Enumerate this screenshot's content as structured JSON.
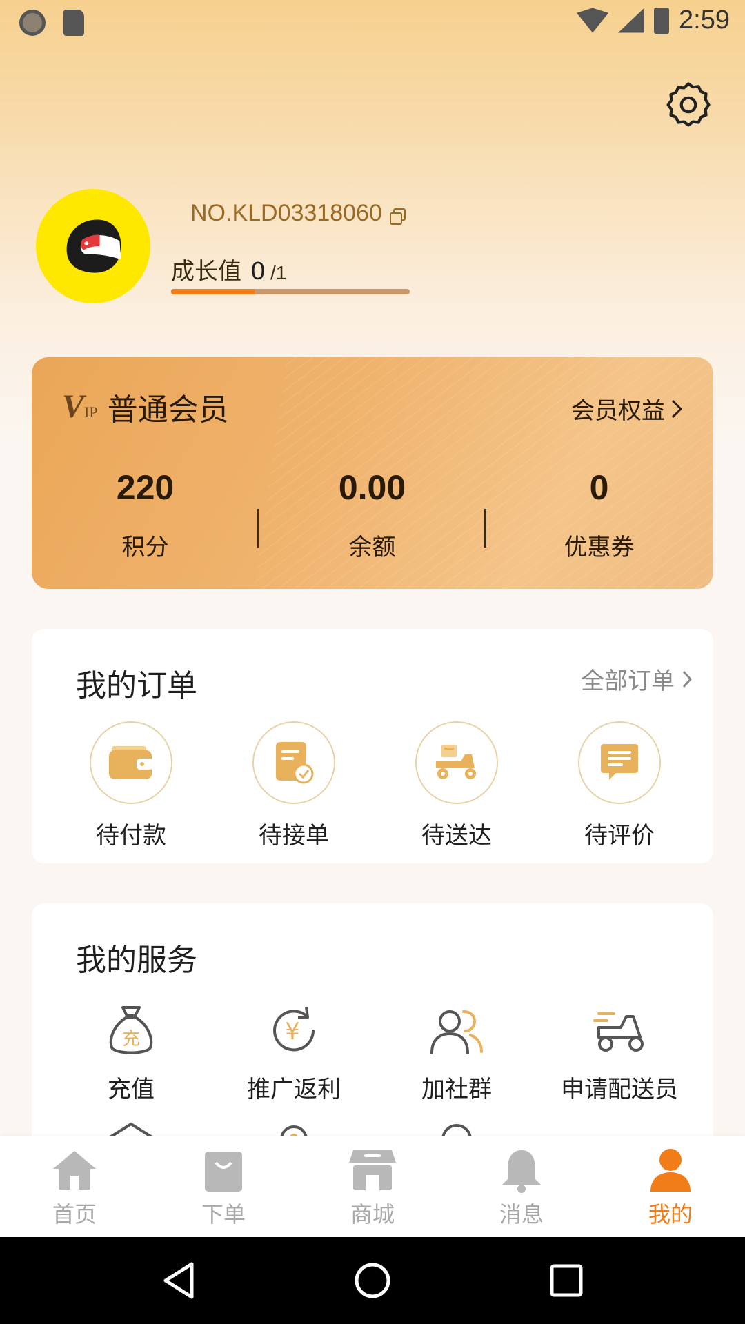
{
  "status_bar": {
    "time": "2:59"
  },
  "profile": {
    "member_no": "NO.KLD03318060",
    "growth_label": "成长值",
    "growth_value": "0",
    "growth_max": "/1",
    "growth_progress": 0.35
  },
  "vip": {
    "logo_main": "V",
    "logo_sub": "IP",
    "level": "普通会员",
    "benefits_link": "会员权益",
    "stats": [
      {
        "value": "220",
        "label": "积分"
      },
      {
        "value": "0.00",
        "label": "余额"
      },
      {
        "value": "0",
        "label": "优惠券"
      }
    ]
  },
  "orders": {
    "title": "我的订单",
    "all_link": "全部订单",
    "items": [
      {
        "label": "待付款",
        "icon": "wallet-icon"
      },
      {
        "label": "待接单",
        "icon": "order-check-icon"
      },
      {
        "label": "待送达",
        "icon": "delivery-scooter-icon"
      },
      {
        "label": "待评价",
        "icon": "comment-icon"
      }
    ]
  },
  "services": {
    "title": "我的服务",
    "items": [
      {
        "label": "充值",
        "icon": "money-bag-icon",
        "glyph": "充"
      },
      {
        "label": "推广返利",
        "icon": "yuan-refresh-icon",
        "glyph": "¥"
      },
      {
        "label": "加社群",
        "icon": "group-users-icon"
      },
      {
        "label": "申请配送员",
        "icon": "courier-scooter-icon"
      }
    ]
  },
  "tabs": [
    {
      "label": "首页",
      "icon": "home-icon",
      "active": false
    },
    {
      "label": "下单",
      "icon": "shopping-bag-icon",
      "active": false
    },
    {
      "label": "商城",
      "icon": "store-icon",
      "active": false
    },
    {
      "label": "消息",
      "icon": "bell-icon",
      "active": false
    },
    {
      "label": "我的",
      "icon": "person-icon",
      "active": true
    }
  ],
  "colors": {
    "accent": "#f07d17",
    "card_gold": "#eaa657",
    "gold_icon": "#e8b25c"
  }
}
